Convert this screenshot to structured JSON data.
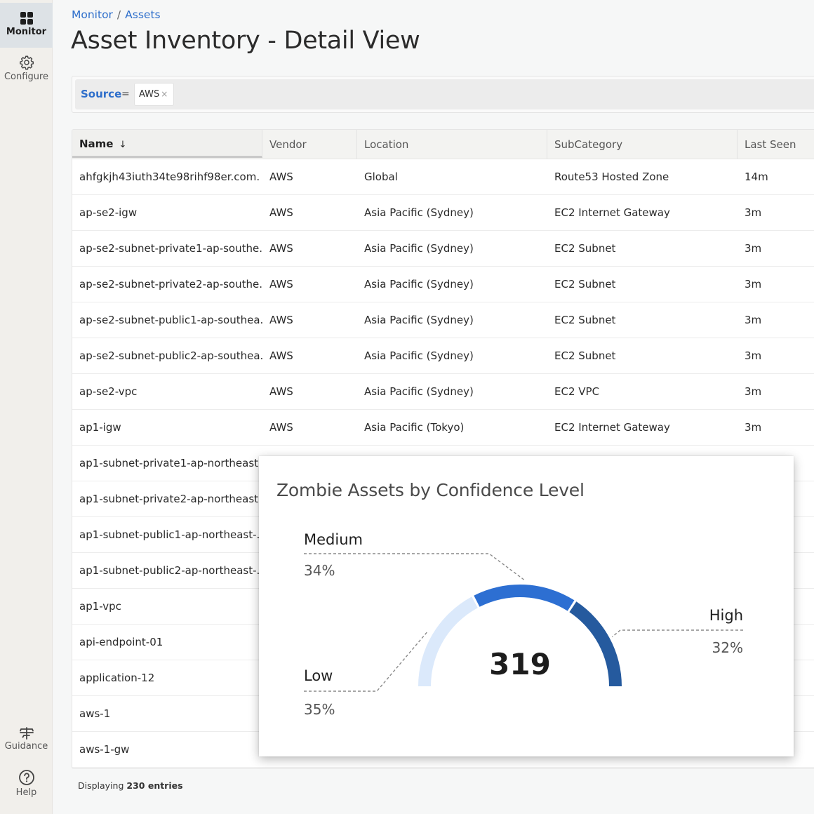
{
  "sidebar": {
    "items": [
      {
        "label": "Monitor",
        "icon": "grid-icon",
        "active": true
      },
      {
        "label": "Configure",
        "icon": "gear-icon",
        "active": false
      }
    ],
    "bottom_items": [
      {
        "label": "Guidance",
        "icon": "signpost-icon"
      },
      {
        "label": "Help",
        "icon": "help-circle-icon"
      }
    ]
  },
  "header": {
    "breadcrumb": [
      "Monitor",
      "Assets"
    ],
    "breadcrumb_separator": "/",
    "title": "Asset Inventory - Detail View"
  },
  "filter": {
    "key": "Source",
    "operator": "=",
    "value": "AWS",
    "remove_glyph": "×"
  },
  "table": {
    "columns": [
      {
        "label": "Name",
        "sort": "↓"
      },
      {
        "label": "Vendor"
      },
      {
        "label": "Location"
      },
      {
        "label": "SubCategory"
      },
      {
        "label": "Last Seen"
      }
    ],
    "rows": [
      {
        "name": "ahfgkjh43iuth34te98rihf98er.com.",
        "vendor": "AWS",
        "location": "Global",
        "subcategory": "Route53 Hosted Zone",
        "last_seen": "14m"
      },
      {
        "name": "ap-se2-igw",
        "vendor": "AWS",
        "location": "Asia Pacific (Sydney)",
        "subcategory": "EC2 Internet Gateway",
        "last_seen": "3m"
      },
      {
        "name": "ap-se2-subnet-private1-ap-southe...",
        "vendor": "AWS",
        "location": "Asia Pacific (Sydney)",
        "subcategory": "EC2 Subnet",
        "last_seen": "3m"
      },
      {
        "name": "ap-se2-subnet-private2-ap-southe...",
        "vendor": "AWS",
        "location": "Asia Pacific (Sydney)",
        "subcategory": "EC2 Subnet",
        "last_seen": "3m"
      },
      {
        "name": "ap-se2-subnet-public1-ap-southea...",
        "vendor": "AWS",
        "location": "Asia Pacific (Sydney)",
        "subcategory": "EC2 Subnet",
        "last_seen": "3m"
      },
      {
        "name": "ap-se2-subnet-public2-ap-southea...",
        "vendor": "AWS",
        "location": "Asia Pacific (Sydney)",
        "subcategory": "EC2 Subnet",
        "last_seen": "3m"
      },
      {
        "name": "ap-se2-vpc",
        "vendor": "AWS",
        "location": "Asia Pacific (Sydney)",
        "subcategory": "EC2 VPC",
        "last_seen": "3m"
      },
      {
        "name": "ap1-igw",
        "vendor": "AWS",
        "location": "Asia Pacific (Tokyo)",
        "subcategory": "EC2 Internet Gateway",
        "last_seen": "3m"
      },
      {
        "name": "ap1-subnet-private1-ap-northeast...",
        "vendor": "",
        "location": "",
        "subcategory": "",
        "last_seen": ""
      },
      {
        "name": "ap1-subnet-private2-ap-northeast...",
        "vendor": "",
        "location": "",
        "subcategory": "",
        "last_seen": ""
      },
      {
        "name": "ap1-subnet-public1-ap-northeast-...",
        "vendor": "",
        "location": "",
        "subcategory": "",
        "last_seen": ""
      },
      {
        "name": "ap1-subnet-public2-ap-northeast-...",
        "vendor": "",
        "location": "",
        "subcategory": "",
        "last_seen": ""
      },
      {
        "name": "ap1-vpc",
        "vendor": "",
        "location": "",
        "subcategory": "",
        "last_seen": ""
      },
      {
        "name": "api-endpoint-01",
        "vendor": "",
        "location": "",
        "subcategory": "",
        "last_seen": ""
      },
      {
        "name": "application-12",
        "vendor": "",
        "location": "",
        "subcategory": "",
        "last_seen": ""
      },
      {
        "name": "aws-1",
        "vendor": "",
        "location": "",
        "subcategory": "",
        "last_seen": ""
      },
      {
        "name": "aws-1-gw",
        "vendor": "",
        "location": "",
        "subcategory": "",
        "last_seen": ""
      }
    ]
  },
  "footer": {
    "prefix": "Displaying",
    "count_text": "230 entries"
  },
  "colors": {
    "accent": "#2f6fcb",
    "low": "#dbe9fb",
    "medium": "#2d6fd2",
    "high": "#255a9e"
  },
  "chart_data": {
    "type": "pie",
    "variant": "semi-donut-gauge",
    "title": "Zombie Assets by Confidence Level",
    "total": 319,
    "categories": [
      "Low",
      "Medium",
      "High"
    ],
    "values": [
      35,
      34,
      32
    ],
    "value_labels": [
      "35%",
      "34%",
      "32%"
    ],
    "unit": "%",
    "legend": "callout-labels"
  }
}
